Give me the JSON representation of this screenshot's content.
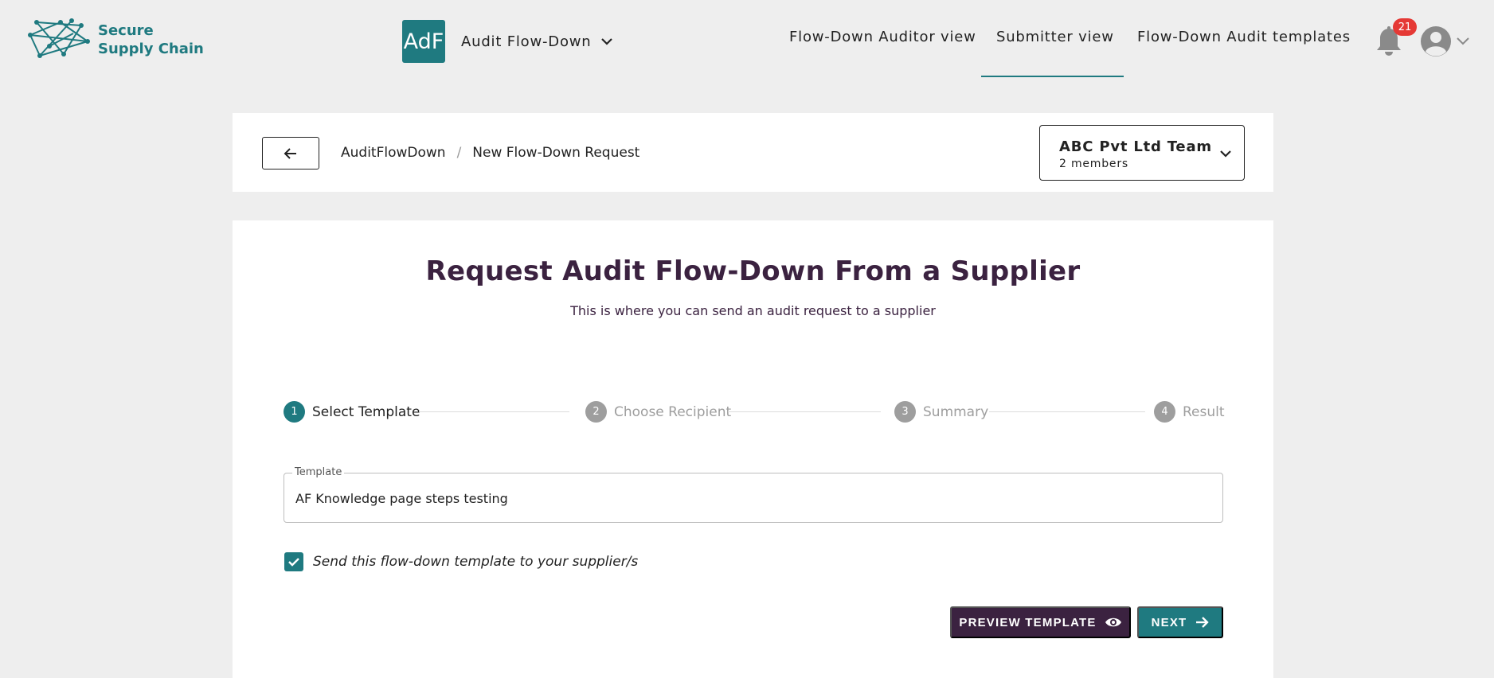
{
  "brand": {
    "name_line1": "Secure",
    "name_line2": "Supply Chain",
    "accent_color": "#1f7a80",
    "secondary_color": "#3b2240"
  },
  "app_switcher": {
    "badge": "AdF",
    "name": "Audit Flow-Down",
    "icon": "chevron-down-icon"
  },
  "nav": {
    "items": [
      {
        "label": "Flow-Down Auditor view",
        "active": false
      },
      {
        "label": "Submitter view",
        "active": true
      },
      {
        "label": "Flow-Down Audit templates",
        "active": false
      }
    ],
    "notifications_count": "21",
    "notification_icon": "bell-icon",
    "user_icon": "user-avatar-icon"
  },
  "breadcrumb": {
    "back_icon": "arrow-left-icon",
    "items": [
      "AuditFlowDown",
      "New Flow-Down Request"
    ],
    "separator": "/"
  },
  "team": {
    "name": "ABC Pvt Ltd Team",
    "members": "2 members"
  },
  "page": {
    "title": "Request Audit Flow-Down From a Supplier",
    "subtitle": "This is where you can send an audit request to a supplier"
  },
  "stepper": {
    "steps": [
      {
        "number": "1",
        "label": "Select Template",
        "active": true
      },
      {
        "number": "2",
        "label": "Choose Recipient",
        "active": false
      },
      {
        "number": "3",
        "label": "Summary",
        "active": false
      },
      {
        "number": "4",
        "label": "Result",
        "active": false
      }
    ]
  },
  "form": {
    "template_label": "Template",
    "template_value": "AF Knowledge page steps testing",
    "send_checkbox_checked": true,
    "send_checkbox_label": "Send this flow-down template to your supplier/s"
  },
  "actions": {
    "preview_label": "PREVIEW TEMPLATE",
    "preview_icon": "eye-icon",
    "next_label": "NEXT",
    "next_icon": "arrow-right-icon"
  }
}
